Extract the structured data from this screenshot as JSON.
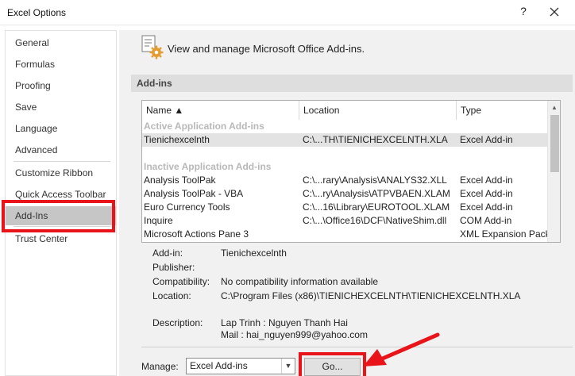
{
  "window": {
    "title": "Excel Options",
    "help_glyph": "?",
    "close_icon": "close-icon"
  },
  "nav": {
    "items": [
      {
        "label": "General"
      },
      {
        "label": "Formulas"
      },
      {
        "label": "Proofing"
      },
      {
        "label": "Save"
      },
      {
        "label": "Language"
      },
      {
        "label": "Advanced"
      },
      {
        "label": "Customize Ribbon"
      },
      {
        "label": "Quick Access Toolbar"
      },
      {
        "label": "Add-Ins"
      },
      {
        "label": "Trust Center"
      }
    ],
    "selected": "Add-Ins"
  },
  "header": {
    "text": "View and manage Microsoft Office Add-ins.",
    "icon": "addins-gear-icon"
  },
  "section": {
    "title": "Add-ins"
  },
  "addin_list": {
    "columns": [
      "Name ▲",
      "Location",
      "Type"
    ],
    "active_group": "Active Application Add-ins",
    "active_rows": [
      {
        "name": "Tienichexcelnth",
        "location": "C:\\...TH\\TIENICHEXCELNTH.XLA",
        "type": "Excel Add-in"
      }
    ],
    "inactive_group": "Inactive Application Add-ins",
    "inactive_rows": [
      {
        "name": "Analysis ToolPak",
        "location": "C:\\...rary\\Analysis\\ANALYS32.XLL",
        "type": "Excel Add-in"
      },
      {
        "name": "Analysis ToolPak - VBA",
        "location": "C:\\...ry\\Analysis\\ATPVBAEN.XLAM",
        "type": "Excel Add-in"
      },
      {
        "name": "Euro Currency Tools",
        "location": "C:\\...16\\Library\\EUROTOOL.XLAM",
        "type": "Excel Add-in"
      },
      {
        "name": "Inquire",
        "location": "C:\\...\\Office16\\DCF\\NativeShim.dll",
        "type": "COM Add-in"
      },
      {
        "name": "Microsoft Actions Pane 3",
        "location": "",
        "type": "XML Expansion Pack"
      }
    ]
  },
  "details": {
    "addin_label": "Add-in:",
    "addin_value": "Tienichexcelnth",
    "publisher_label": "Publisher:",
    "publisher_value": "",
    "compat_label": "Compatibility:",
    "compat_value": "No compatibility information available",
    "location_label": "Location:",
    "location_value": "C:\\Program Files (x86)\\TIENICHEXCELNTH\\TIENICHEXCELNTH.XLA",
    "description_label": "Description:",
    "description_line1": "Lap Trinh : Nguyen Thanh Hai",
    "description_line2": "Mail : hai_nguyen999@yahoo.com"
  },
  "manage": {
    "label": "Manage:",
    "selected": "Excel Add-ins",
    "go_label": "Go..."
  },
  "colors": {
    "highlight": "#e8141a",
    "selected_nav": "#c6c6c6",
    "panel_bg": "#f1f1f1"
  }
}
